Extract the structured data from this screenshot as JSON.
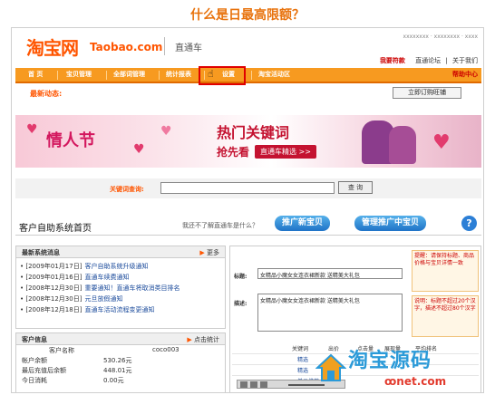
{
  "caption": "什么是日最高限额？",
  "header": {
    "logo": "淘宝网",
    "logo_sub": "Taobao.com",
    "product": "直通车",
    "account": "xxxxxxxx · xxxxxxxx · xxxx",
    "links": {
      "welcome": "我要符款",
      "forum": "直通论坛",
      "about": "关于我们"
    }
  },
  "nav": {
    "items": [
      "首 页",
      "宝贝管理",
      "全部词管理",
      "统计报表",
      "设置",
      "淘宝活动区"
    ],
    "help": "帮助中心"
  },
  "news": {
    "label": "最新动态:",
    "order_button": "立即订购旺铺"
  },
  "banner": {
    "valentine": "情人节",
    "hot_keywords": "热门关键词",
    "grab_first": "抢先看",
    "select_button": "直通车精选 >>"
  },
  "search": {
    "label": "关键词查询:",
    "button": "查 询"
  },
  "system": {
    "title": "客户自助系统首页",
    "question": "我还不了解直通车是什么？",
    "promote_button": "推广新宝贝",
    "manage_button": "管理推广中宝贝",
    "help_icon_glyph": "?"
  },
  "announcements": {
    "title": "最新系统消息",
    "more": "更多",
    "items": [
      {
        "date": "• [2009年01月17日]",
        "text": "客户自助系统升级通知"
      },
      {
        "date": "• [2009年01月16日]",
        "text": "直通车续费通知"
      },
      {
        "date": "• [2008年12月30日]",
        "text": "重要通知！直通车将取消类目排名"
      },
      {
        "date": "• [2008年12月30日]",
        "text": "元旦放假通知"
      },
      {
        "date": "• [2008年12月18日]",
        "text": "直通车活动流程变更通知"
      }
    ]
  },
  "customer": {
    "title": "客户信息",
    "stats_link": "点击统计",
    "rows": [
      {
        "label": "客户名称",
        "value": "coco003"
      },
      {
        "label": "帐户余额",
        "value": "530.26元"
      },
      {
        "label": "最后充值后余额",
        "value": "448.01元"
      },
      {
        "label": "今日消耗",
        "value": "0.00元"
      }
    ]
  },
  "right_panel": {
    "field1_label": "标题:",
    "field1_value": "女精品小魔女女连衣裙新款 送精美大礼包",
    "field2_label": "描述:",
    "field2_value": "女精品小魔女女连衣裙新款 送精美大礼包",
    "note1": "提醒：请保持标题、商品价格与宝贝详情一致",
    "note2": "说明：标题不超过20个汉字，描述不超过80个汉字",
    "grid_headers": [
      "关键词",
      "出价",
      "点击量",
      "展现量",
      "平均排名"
    ],
    "grid_links": [
      "精选",
      "精选",
      "单元推荐"
    ]
  },
  "watermark": {
    "big": "淘宝源码",
    "small": "ꝏnet.com"
  },
  "colors": {
    "accent": "#ff5500",
    "nav_bg": "#f79a20",
    "highlight": "#e00000",
    "link": "#1a4a9b",
    "button_blue": "#1f73c7"
  }
}
